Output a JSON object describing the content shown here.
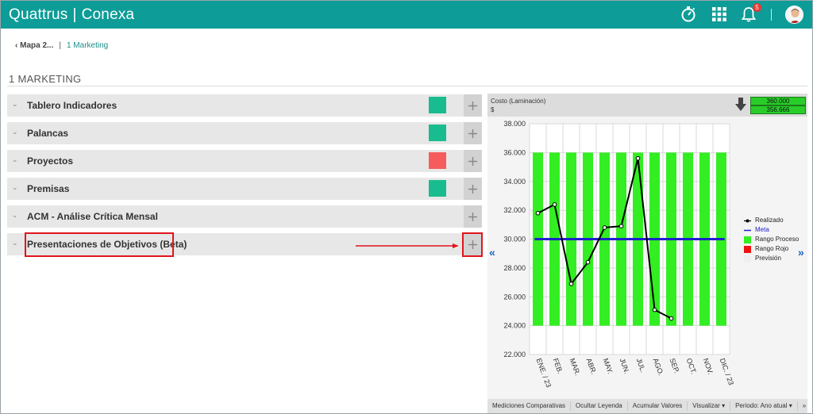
{
  "app": {
    "brand_left": "Quattrus",
    "brand_right": "Conexa",
    "notification_count": "5"
  },
  "breadcrumb": {
    "back": "Mapa 2...",
    "current": "1 Marketing"
  },
  "page_title": "1 MARKETING",
  "sections": [
    {
      "label": "Tablero Indicadores",
      "status": "#19bc8f"
    },
    {
      "label": "Palancas",
      "status": "#19bc8f"
    },
    {
      "label": "Proyectos",
      "status": "#f75c5c"
    },
    {
      "label": "Premisas",
      "status": "#19bc8f"
    },
    {
      "label": "ACM - Análise Crítica Mensal",
      "status": ""
    },
    {
      "label": "Presentaciones de Objetivos (Beta)",
      "status": ""
    }
  ],
  "chart_panel": {
    "title": "Costo (Laminación)",
    "unit": "$",
    "meta_value": "360.000",
    "real_value": "356.666"
  },
  "chart_data": {
    "type": "line",
    "categories": [
      "ENE. / 23",
      "FEB.",
      "MAR.",
      "ABR.",
      "MAY.",
      "JUN.",
      "JUL.",
      "AGO.",
      "SEP.",
      "OCT.",
      "NOV.",
      "DIC. / 23"
    ],
    "ylim": [
      22000,
      38000
    ],
    "yticks": [
      "22.000",
      "24.000",
      "26.000",
      "28.000",
      "30.000",
      "32.000",
      "34.000",
      "36.000",
      "38.000"
    ],
    "series": [
      {
        "name": "Realizado",
        "values": [
          31800,
          32400,
          26900,
          28400,
          30800,
          30900,
          35600,
          25100,
          24500,
          null,
          null,
          null
        ],
        "color": "#000000"
      },
      {
        "name": "Meta",
        "values": [
          30000,
          30000,
          30000,
          30000,
          30000,
          30000,
          30000,
          30000,
          30000,
          30000,
          30000,
          30000
        ],
        "color": "#2020cc"
      },
      {
        "name": "Rango Proceso",
        "range": [
          24000,
          36000
        ],
        "color": "#33ee22"
      },
      {
        "name": "Rango Rojo",
        "color": "#ee1111"
      },
      {
        "name": "Previsión",
        "color": "#eeeeee"
      }
    ],
    "grid": true,
    "legend": "right"
  },
  "toolbar": {
    "mediciones": "Mediciones Comparativas",
    "ocultar": "Ocultar Leyenda",
    "acumular": "Acumular Valores",
    "visualizar": "Visualizar",
    "periodo": "Periodo: Ano atual"
  }
}
